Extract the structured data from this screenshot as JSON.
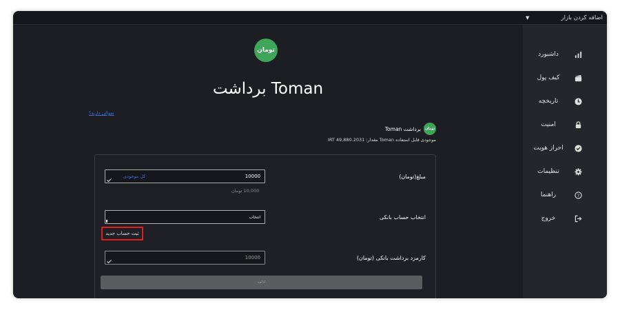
{
  "topbar": {
    "market_select": "اضافه کردن بازار"
  },
  "sidebar": {
    "items": [
      {
        "label": "داشبورد",
        "icon": "bar-chart-icon"
      },
      {
        "label": "کیف پول",
        "icon": "wallet-icon"
      },
      {
        "label": "تاریخچه",
        "icon": "clock-icon"
      },
      {
        "label": "امنیت",
        "icon": "lock-icon"
      },
      {
        "label": "احراز هویت",
        "icon": "check-circle-icon"
      },
      {
        "label": "تنظیمات",
        "icon": "gear-icon"
      },
      {
        "label": "راهنما",
        "icon": "help-circle-icon"
      },
      {
        "label": "خروج",
        "icon": "logout-icon"
      }
    ]
  },
  "main": {
    "logo_text": "تومان",
    "title": "برداشت Toman",
    "help_link": "سوالی دارید؟",
    "asset": {
      "icon_text": "تومان",
      "name": "برداشت Toman"
    },
    "balance": "موجودی قابل استفاده Toman مقدار: IRT 49,880.2031",
    "form": {
      "amount_label": "مبلغ(تومان)",
      "amount_value": "10000",
      "all_balance_link": "کل موجودی",
      "amount_hint": "10,000 تومان",
      "bank_label": "انتخاب حساب بانکی",
      "bank_value": "انتخاب",
      "new_account": "ثبت حساب جدید",
      "fee_label": "کارمزد برداشت بانکی (تومان)",
      "fee_value": "10000",
      "submit": "ادامه"
    }
  },
  "colors": {
    "accent_green": "#3fa55b",
    "link_blue": "#3d6fe0",
    "highlight_red": "#e01e1e"
  }
}
